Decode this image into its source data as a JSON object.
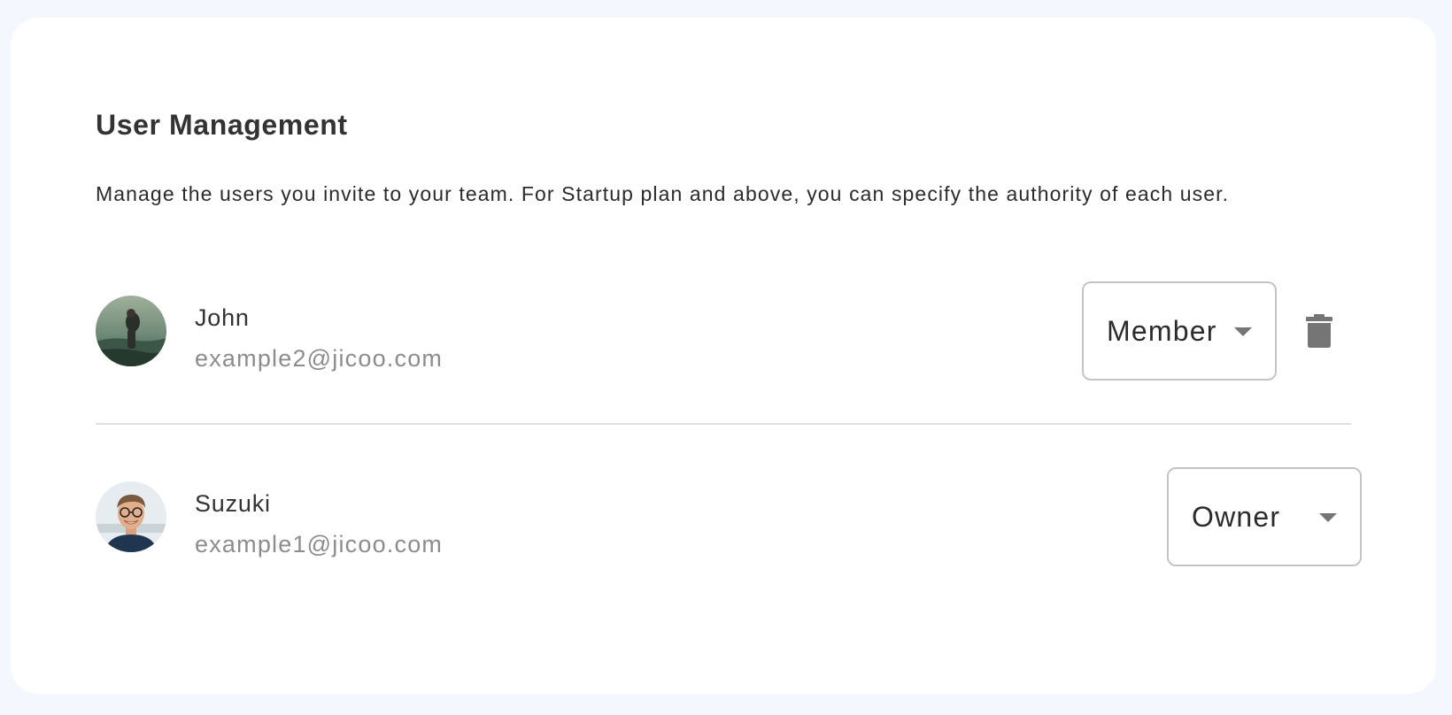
{
  "section": {
    "title": "User Management",
    "description": "Manage the users you invite to your team. For Startup plan and above, you can specify the authority of each user."
  },
  "users": [
    {
      "name": "John",
      "email": "example2@jicoo.com",
      "role": "Member",
      "avatar_icon": "user-photo-hiker",
      "delete_icon": "trash-icon"
    },
    {
      "name": "Suzuki",
      "email": "example1@jicoo.com",
      "role": "Owner",
      "avatar_icon": "user-photo-smiling-man"
    }
  ],
  "colors": {
    "background": "#f4f7fd",
    "card": "#ffffff",
    "text_primary": "#333333",
    "text_secondary": "#8c8c8c",
    "border": "#c4c4c4",
    "icon": "#757575",
    "divider": "#e0e0e0"
  }
}
